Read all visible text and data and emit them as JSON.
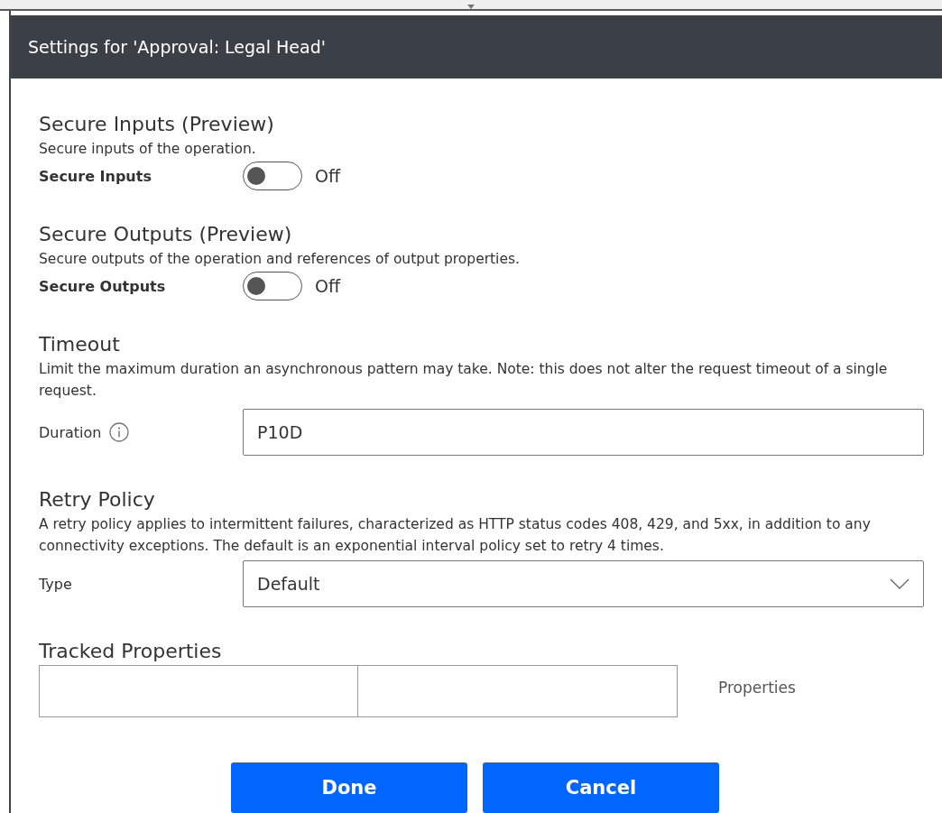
{
  "dialog": {
    "title": "Settings for 'Approval: Legal Head'"
  },
  "sections": [
    {
      "kind": "toggle",
      "heading": "Secure Inputs (Preview)",
      "description": "Secure inputs of the operation.",
      "label": "Secure Inputs",
      "on": false,
      "state_text": "Off"
    },
    {
      "kind": "toggle",
      "heading": "Secure Outputs (Preview)",
      "description": "Secure outputs of the operation and references of output properties.",
      "label": "Secure Outputs",
      "on": false,
      "state_text": "Off"
    },
    {
      "kind": "text",
      "heading": "Timeout",
      "description": "Limit the maximum duration an asynchronous pattern may take. Note: this does not alter the request timeout of a single request.",
      "label": "Duration",
      "value": "P10D"
    },
    {
      "kind": "select",
      "heading": "Retry Policy",
      "description": "A retry policy applies to intermittent failures, characterized as HTTP status codes 408, 429, and 5xx, in addition to any connectivity exceptions. The default is an exponential interval policy set to retry 4 times.",
      "label": "Type",
      "value": "Default"
    },
    {
      "kind": "pairs",
      "heading": "Tracked Properties",
      "side_label": "Properties"
    }
  ],
  "buttons": [
    "Done",
    "Cancel"
  ]
}
